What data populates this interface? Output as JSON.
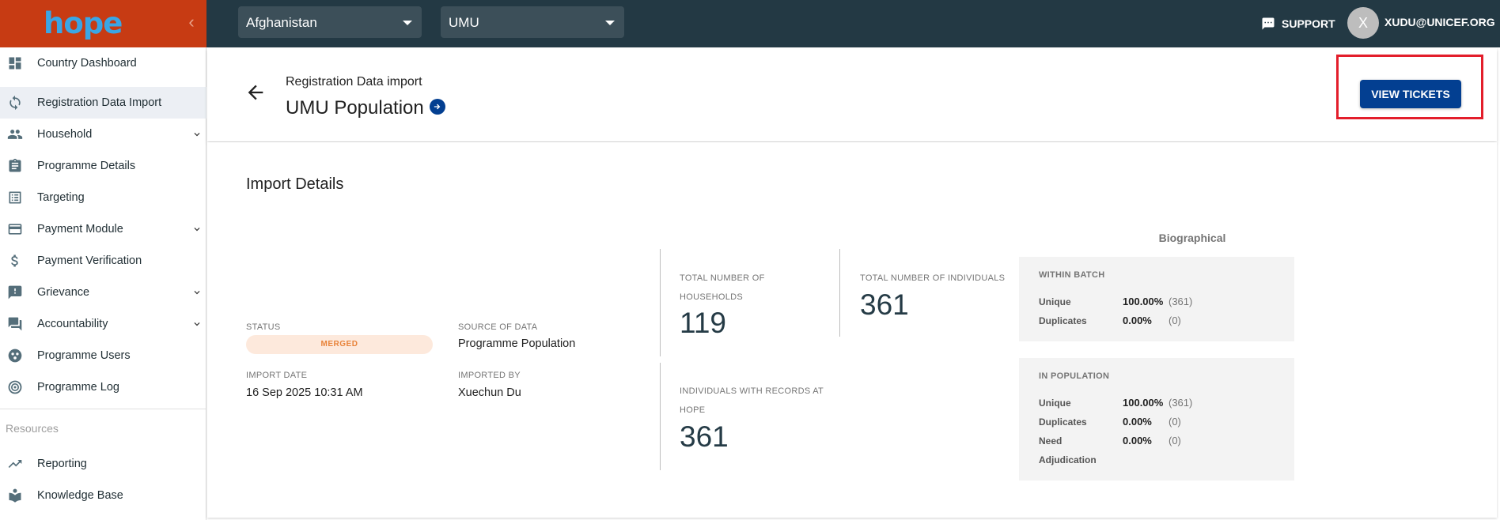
{
  "app": {
    "logo_text": "hope",
    "colors": {
      "topbar": "#233944",
      "logo_bg": "#c73b13",
      "primary": "#033f91",
      "highlight": "#e31e2b"
    }
  },
  "topbar": {
    "country_select": "Afghanistan",
    "programme_select": "UMU",
    "support_label": "SUPPORT",
    "avatar_initial": "X",
    "user_email": "XUDU@UNICEF.ORG"
  },
  "sidebar": {
    "items": [
      {
        "label": "Country Dashboard",
        "icon": "dashboard-icon",
        "expandable": false,
        "active": false
      },
      {
        "label": "Registration Data Import",
        "icon": "sync-icon",
        "expandable": false,
        "active": true
      },
      {
        "label": "Household",
        "icon": "people-icon",
        "expandable": true,
        "active": false
      },
      {
        "label": "Programme Details",
        "icon": "clipboard-icon",
        "expandable": false,
        "active": false
      },
      {
        "label": "Targeting",
        "icon": "list-icon",
        "expandable": false,
        "active": false
      },
      {
        "label": "Payment Module",
        "icon": "credit-card-icon",
        "expandable": true,
        "active": false
      },
      {
        "label": "Payment Verification",
        "icon": "dollar-icon",
        "expandable": false,
        "active": false
      },
      {
        "label": "Grievance",
        "icon": "feedback-icon",
        "expandable": true,
        "active": false
      },
      {
        "label": "Accountability",
        "icon": "forum-icon",
        "expandable": true,
        "active": false
      },
      {
        "label": "Programme Users",
        "icon": "users-circle-icon",
        "expandable": false,
        "active": false
      },
      {
        "label": "Programme Log",
        "icon": "history-icon",
        "expandable": false,
        "active": false
      }
    ],
    "resources_label": "Resources",
    "resource_items": [
      {
        "label": "Reporting",
        "icon": "trending-up-icon"
      },
      {
        "label": "Knowledge Base",
        "icon": "book-icon"
      }
    ]
  },
  "header": {
    "breadcrumb": "Registration Data import",
    "title": "UMU Population",
    "view_tickets_label": "VIEW TICKETS"
  },
  "details": {
    "section_title": "Import Details",
    "status_label": "STATUS",
    "status_value": "MERGED",
    "source_label": "SOURCE OF DATA",
    "source_value": "Programme Population",
    "import_date_label": "IMPORT DATE",
    "import_date_value": "16 Sep 2025 10:31 AM",
    "imported_by_label": "IMPORTED BY",
    "imported_by_value": "Xuechun Du",
    "households_label_1": "TOTAL NUMBER OF",
    "households_label_2": "HOUSEHOLDS",
    "households_value": "119",
    "individuals_label": "TOTAL NUMBER OF INDIVIDUALS",
    "individuals_value": "361",
    "records_label_1": "INDIVIDUALS WITH RECORDS AT",
    "records_label_2": "HOPE",
    "records_value": "361"
  },
  "biographical": {
    "title": "Biographical",
    "within_batch": {
      "heading": "WITHIN BATCH",
      "unique_label": "Unique",
      "unique_pct": "100.00%",
      "unique_count": "(361)",
      "dup_label": "Duplicates",
      "dup_pct": "0.00%",
      "dup_count": "(0)"
    },
    "in_population": {
      "heading": "IN POPULATION",
      "unique_label": "Unique",
      "unique_pct": "100.00%",
      "unique_count": "(361)",
      "dup_label": "Duplicates",
      "dup_pct": "0.00%",
      "dup_count": "(0)",
      "need_label_1": "Need",
      "need_label_2": "Adjudication",
      "need_pct": "0.00%",
      "need_count": "(0)"
    }
  }
}
